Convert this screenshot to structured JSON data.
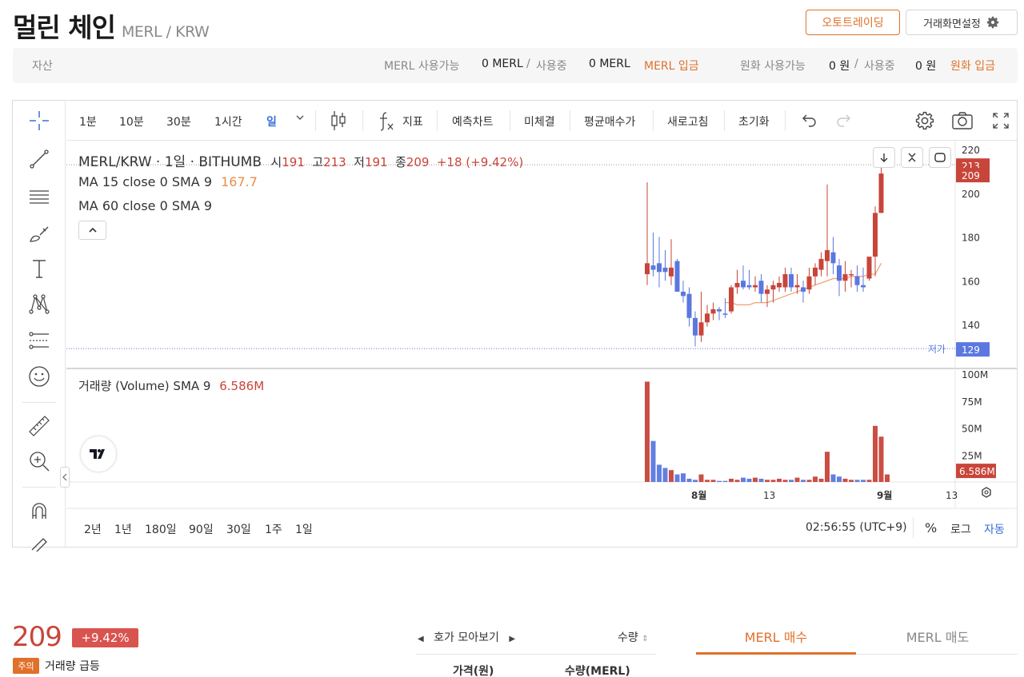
{
  "header": {
    "coin_name": "멀린 체인",
    "pair": "MERL / KRW",
    "auto_trading": "오토트레이딩",
    "screen_settings": "거래화면설정"
  },
  "asset_bar": {
    "label": "자산",
    "merl_available_label": "MERL 사용가능",
    "merl_available_value": "0 MERL",
    "slash": "/",
    "in_use_label": "사용중",
    "merl_in_use_value": "0 MERL",
    "merl_deposit": "MERL 입금",
    "krw_available_label": "원화 사용가능",
    "krw_available_value": "0 원",
    "krw_in_use_value": "0 원",
    "krw_deposit": "원화 입금"
  },
  "toolbar": {
    "intervals": [
      "1분",
      "10분",
      "30분",
      "1시간",
      "일"
    ],
    "active_interval": "일",
    "indicators": "지표",
    "forecast_chart": "예측차트",
    "unfilled": "미체결",
    "avg_buy_price": "평균매수가",
    "refresh": "새로고침",
    "reset": "초기화"
  },
  "legend": {
    "title": "MERL/KRW · 1일 · BITHUMB",
    "open_label": "시",
    "open": "191",
    "high_label": "고",
    "high": "213",
    "low_label": "저",
    "low": "191",
    "close_label": "종",
    "close": "209",
    "change": "+18 (+9.42%)",
    "ma15_label": "MA 15 close 0 SMA 9",
    "ma15_value": "167.7",
    "ma60_label": "MA 60 close 0 SMA 9",
    "volume_label": "거래량 (Volume) SMA 9",
    "volume_value": "6.586M",
    "low_marker_label": "저가"
  },
  "price_axis": {
    "ticks": [
      "220",
      "200",
      "180",
      "160",
      "140"
    ],
    "badge_high": "213",
    "badge_close": "209",
    "badge_low": "129"
  },
  "volume_axis": {
    "ticks": [
      "100M",
      "75M",
      "50M",
      "25M"
    ],
    "badge": "6.586M"
  },
  "time_axis": {
    "labels": [
      "8월",
      "13",
      "9월",
      "13"
    ]
  },
  "bottom_bar": {
    "ranges": [
      "2년",
      "1년",
      "180일",
      "90일",
      "30일",
      "1주",
      "1일"
    ],
    "clock": "02:56:55 (UTC+9)",
    "percent": "%",
    "log": "로그",
    "auto": "자동"
  },
  "colors": {
    "up": "#c8453a",
    "down": "#5b78e0",
    "accent": "#e0712a",
    "ma": "#f0a070"
  },
  "chart_data": {
    "type": "candlestick",
    "interval": "1일",
    "candles": [
      {
        "o": 163,
        "h": 205,
        "l": 158,
        "c": 168,
        "dir": "up"
      },
      {
        "o": 167,
        "h": 182,
        "l": 162,
        "c": 165,
        "dir": "down"
      },
      {
        "o": 168,
        "h": 180,
        "l": 157,
        "c": 164,
        "dir": "down"
      },
      {
        "o": 166,
        "h": 174,
        "l": 160,
        "c": 164,
        "dir": "down"
      },
      {
        "o": 162,
        "h": 179,
        "l": 158,
        "c": 166,
        "dir": "up"
      },
      {
        "o": 169,
        "h": 170,
        "l": 157,
        "c": 155,
        "dir": "down"
      },
      {
        "o": 155,
        "h": 160,
        "l": 150,
        "c": 153,
        "dir": "down"
      },
      {
        "o": 154,
        "h": 157,
        "l": 139,
        "c": 143,
        "dir": "down"
      },
      {
        "o": 143,
        "h": 146,
        "l": 130,
        "c": 135,
        "dir": "down"
      },
      {
        "o": 135,
        "h": 155,
        "l": 132,
        "c": 141,
        "dir": "up"
      },
      {
        "o": 141,
        "h": 149,
        "l": 139,
        "c": 145,
        "dir": "up"
      },
      {
        "o": 145,
        "h": 150,
        "l": 142,
        "c": 147,
        "dir": "up"
      },
      {
        "o": 147,
        "h": 148,
        "l": 142,
        "c": 146,
        "dir": "down"
      },
      {
        "o": 145,
        "h": 152,
        "l": 143,
        "c": 145,
        "dir": "down"
      },
      {
        "o": 146,
        "h": 158,
        "l": 145,
        "c": 157,
        "dir": "up"
      },
      {
        "o": 157,
        "h": 165,
        "l": 154,
        "c": 159,
        "dir": "up"
      },
      {
        "o": 160,
        "h": 167,
        "l": 156,
        "c": 157,
        "dir": "down"
      },
      {
        "o": 158,
        "h": 165,
        "l": 156,
        "c": 157,
        "dir": "down"
      },
      {
        "o": 157,
        "h": 162,
        "l": 155,
        "c": 158,
        "dir": "up"
      },
      {
        "o": 160,
        "h": 163,
        "l": 150,
        "c": 154,
        "dir": "down"
      },
      {
        "o": 154,
        "h": 158,
        "l": 148,
        "c": 156,
        "dir": "up"
      },
      {
        "o": 156,
        "h": 160,
        "l": 150,
        "c": 158,
        "dir": "up"
      },
      {
        "o": 157,
        "h": 162,
        "l": 155,
        "c": 159,
        "dir": "up"
      },
      {
        "o": 157,
        "h": 166,
        "l": 155,
        "c": 163,
        "dir": "up"
      },
      {
        "o": 163,
        "h": 166,
        "l": 155,
        "c": 157,
        "dir": "down"
      },
      {
        "o": 157,
        "h": 163,
        "l": 154,
        "c": 158,
        "dir": "up"
      },
      {
        "o": 157,
        "h": 160,
        "l": 150,
        "c": 155,
        "dir": "down"
      },
      {
        "o": 156,
        "h": 166,
        "l": 154,
        "c": 162,
        "dir": "up"
      },
      {
        "o": 162,
        "h": 168,
        "l": 158,
        "c": 166,
        "dir": "up"
      },
      {
        "o": 165,
        "h": 173,
        "l": 162,
        "c": 170,
        "dir": "up"
      },
      {
        "o": 169,
        "h": 204,
        "l": 162,
        "c": 174,
        "dir": "up"
      },
      {
        "o": 173,
        "h": 180,
        "l": 163,
        "c": 168,
        "dir": "down"
      },
      {
        "o": 167,
        "h": 170,
        "l": 153,
        "c": 160,
        "dir": "down"
      },
      {
        "o": 160,
        "h": 169,
        "l": 155,
        "c": 163,
        "dir": "up"
      },
      {
        "o": 163,
        "h": 165,
        "l": 157,
        "c": 163,
        "dir": "up"
      },
      {
        "o": 162,
        "h": 167,
        "l": 155,
        "c": 158,
        "dir": "down"
      },
      {
        "o": 158,
        "h": 166,
        "l": 155,
        "c": 157,
        "dir": "down"
      },
      {
        "o": 161,
        "h": 171,
        "l": 160,
        "c": 171,
        "dir": "up"
      },
      {
        "o": 171,
        "h": 194,
        "l": 162,
        "c": 191,
        "dir": "up"
      },
      {
        "o": 191,
        "h": 213,
        "l": 191,
        "c": 209,
        "dir": "up"
      }
    ],
    "ma_line": [
      150,
      150,
      149,
      149,
      149,
      150,
      150,
      150,
      151,
      152,
      153,
      154,
      155,
      156,
      157,
      158,
      159,
      160,
      161,
      161,
      161,
      162,
      162,
      162,
      163,
      163,
      168
    ],
    "volume_M": [
      93,
      38,
      16,
      13,
      11,
      7,
      8,
      3,
      2,
      7,
      2,
      2,
      1,
      1,
      3,
      2,
      4,
      3,
      4,
      3,
      2,
      2,
      3,
      2,
      2,
      4,
      2,
      2,
      5,
      3,
      28,
      7,
      5,
      3,
      2,
      2,
      2,
      2,
      52,
      42,
      7
    ],
    "price_ylim": [
      129,
      220
    ],
    "volume_ylim": [
      0,
      100
    ],
    "legend_position": "top-left",
    "grid": false
  },
  "orderbook": {
    "price": "209",
    "change_pct": "+9.42%",
    "warning_badge": "주의",
    "warning_text": "거래량 급등",
    "grouping_title": "호가 모아보기",
    "qty_sort": "수량",
    "col_price": "가격(원)",
    "col_qty": "수량(MERL)"
  },
  "trade_tabs": {
    "buy": "MERL 매수",
    "sell": "MERL 매도"
  }
}
